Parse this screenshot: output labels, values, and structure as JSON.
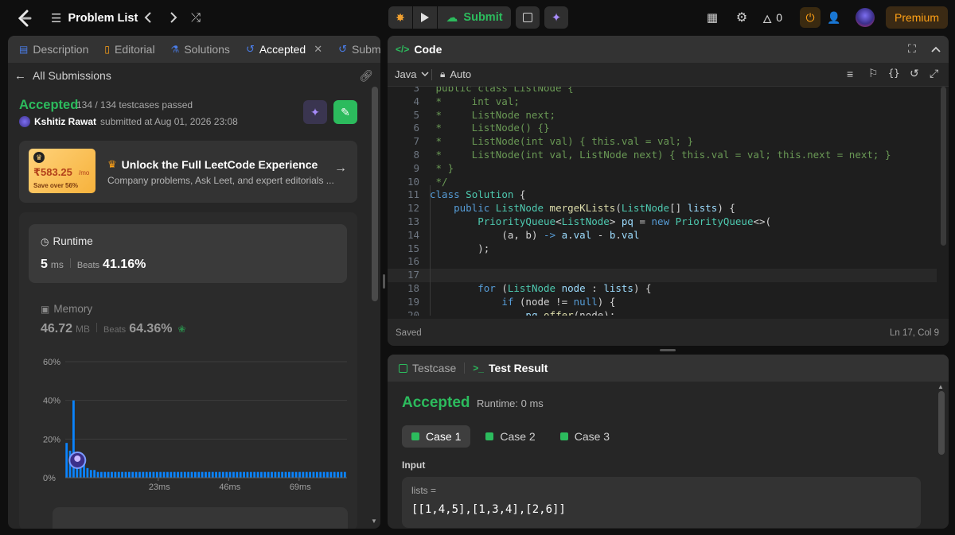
{
  "topbar": {
    "problem_list_label": "Problem List",
    "submit_label": "Submit",
    "streak_count": "0",
    "premium_label": "Premium"
  },
  "left_tabs": [
    {
      "label": "Description",
      "icon": "file-icon"
    },
    {
      "label": "Editorial",
      "icon": "book-icon"
    },
    {
      "label": "Solutions",
      "icon": "flask-icon"
    },
    {
      "label": "Accepted",
      "icon": "history-icon"
    },
    {
      "label": "Submis",
      "icon": "history-icon"
    }
  ],
  "submission": {
    "back_label": "All Submissions",
    "status": "Accepted",
    "testcases": "134 / 134 testcases passed",
    "user": "Kshitiz Rawat",
    "submitted_text": "submitted at Aug 01, 2026 23:08"
  },
  "promo": {
    "price": "₹583.25",
    "per": "/mo",
    "save": "Save over 56%",
    "title": "Unlock the Full LeetCode Experience",
    "subtitle": "Company problems, Ask Leet, and expert editorials ..."
  },
  "runtime": {
    "label": "Runtime",
    "value": "5",
    "unit": "ms",
    "beats_label": "Beats",
    "beats": "41.16%"
  },
  "memory": {
    "label": "Memory",
    "value": "46.72",
    "unit": "MB",
    "beats_label": "Beats",
    "beats": "64.36%"
  },
  "chart_data": {
    "type": "bar",
    "y_ticks": [
      "60%",
      "40%",
      "20%",
      "0%"
    ],
    "ylim": [
      0,
      60
    ],
    "x_ticks": [
      "23ms",
      "46ms",
      "69ms"
    ],
    "values": [
      18,
      14,
      40,
      7,
      5,
      10,
      5,
      4,
      4,
      3,
      3,
      3,
      3,
      3,
      3,
      3,
      3,
      3,
      3,
      3,
      3,
      3,
      3,
      3,
      3,
      3,
      3,
      3,
      3,
      3,
      3,
      3,
      3,
      3,
      3,
      3,
      3,
      3,
      3,
      3,
      3,
      3,
      3,
      3,
      3,
      3,
      3,
      3,
      3,
      3,
      3,
      3,
      3,
      3,
      3,
      3,
      3,
      3,
      3,
      3,
      3,
      3,
      3,
      3,
      3,
      3,
      3,
      3,
      3,
      3,
      3,
      3,
      3,
      3,
      3,
      3,
      3,
      3,
      3,
      3,
      3
    ],
    "highlight_index": 3,
    "bar_color": "#0a84ff"
  },
  "code_panel": {
    "title": "Code",
    "language": "Java",
    "mode": "Auto",
    "status": "Saved",
    "cursor": "Ln 17, Col 9",
    "lines": [
      {
        "n": "3",
        "html": " <span class='cm'>public class ListNode {</span>"
      },
      {
        "n": "4",
        "html": "<span class='cm'> *     int val;</span>"
      },
      {
        "n": "5",
        "html": "<span class='cm'> *     ListNode next;</span>"
      },
      {
        "n": "6",
        "html": "<span class='cm'> *     ListNode() {}</span>"
      },
      {
        "n": "7",
        "html": "<span class='cm'> *     ListNode(int val) { this.val = val; }</span>"
      },
      {
        "n": "8",
        "html": "<span class='cm'> *     ListNode(int val, ListNode next) { this.val = val; this.next = next; }</span>"
      },
      {
        "n": "9",
        "html": "<span class='cm'> * }</span>"
      },
      {
        "n": "10",
        "html": "<span class='cm'> */</span>"
      },
      {
        "n": "11",
        "html": "<span class='kw'>class</span> <span class='ty'>Solution</span> <span class='pl'>{</span>"
      },
      {
        "n": "12",
        "html": "    <span class='kw'>public</span> <span class='ty'>ListNode</span> <span class='fn'>mergeKLists</span><span class='pl'>(</span><span class='ty'>ListNode</span><span class='pl'>[]</span> <span class='vr'>lists</span><span class='pl'>) {</span>"
      },
      {
        "n": "13",
        "html": "        <span class='ty'>PriorityQueue</span><span class='pl'>&lt;</span><span class='ty'>ListNode</span><span class='pl'>&gt;</span> <span class='vr'>pq</span> <span class='pl'>=</span> <span class='kw'>new</span> <span class='ty'>PriorityQueue</span><span class='pl'>&lt;&gt;(</span>"
      },
      {
        "n": "14",
        "html": "            <span class='pl'>(a, b)</span> <span class='kw'>-&gt;</span> <span class='vr'>a</span><span class='pl'>.</span><span class='vr'>val</span> <span class='pl'>-</span> <span class='vr'>b</span><span class='pl'>.</span><span class='vr'>val</span>"
      },
      {
        "n": "15",
        "html": "        <span class='pl'>);</span>"
      },
      {
        "n": "16",
        "html": ""
      },
      {
        "n": "17",
        "html": ""
      },
      {
        "n": "18",
        "html": "        <span class='kw'>for</span> <span class='pl'>(</span><span class='ty'>ListNode</span> <span class='vr'>node</span> <span class='pl'>:</span> <span class='vr'>lists</span><span class='pl'>) {</span>"
      },
      {
        "n": "19",
        "html": "            <span class='kw'>if</span> <span class='pl'>(node !=</span> <span class='kw'>null</span><span class='pl'>) {</span>"
      },
      {
        "n": "20",
        "html": "                <span class='vr'>pq</span><span class='pl'>.</span><span class='fn'>offer</span><span class='pl'>(node);</span>"
      }
    ]
  },
  "test_panel": {
    "testcase_tab": "Testcase",
    "result_tab": "Test Result",
    "status": "Accepted",
    "runtime": "Runtime: 0 ms",
    "cases": [
      "Case 1",
      "Case 2",
      "Case 3"
    ],
    "input_label": "Input",
    "var_label": "lists =",
    "var_value": "[[1,4,5],[1,3,4],[2,6]]"
  }
}
